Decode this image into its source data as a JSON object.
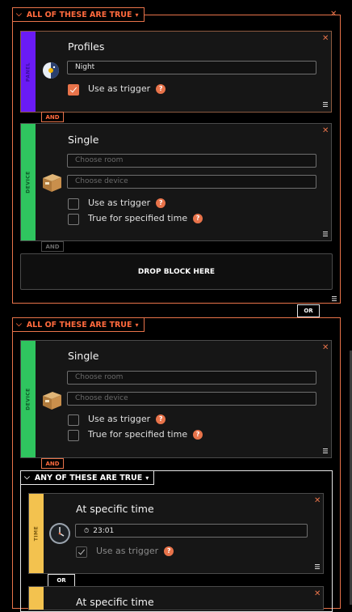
{
  "groups": {
    "all_true_label": "ALL OF THESE ARE TRUE",
    "any_true_label": "ANY OF THESE ARE TRUE"
  },
  "connectors": {
    "and": "AND",
    "or": "OR"
  },
  "stripe_labels": {
    "panel": "PANEL",
    "device": "DEVICE",
    "time": "TIME"
  },
  "profiles_block": {
    "title": "Profiles",
    "value": "Night",
    "trigger_label": "Use as trigger",
    "trigger_checked": true
  },
  "device_block_1": {
    "title": "Single",
    "room_placeholder": "Choose room",
    "device_placeholder": "Choose device",
    "trigger_label": "Use as trigger",
    "time_label": "True for specified time"
  },
  "drop_zone": {
    "label": "DROP BLOCK HERE"
  },
  "device_block_2": {
    "title": "Single",
    "room_placeholder": "Choose room",
    "device_placeholder": "Choose device",
    "trigger_label": "Use as trigger",
    "time_label": "True for specified time"
  },
  "time_block_1": {
    "title": "At specific time",
    "time_value": "23:01",
    "trigger_label": "Use as trigger",
    "trigger_checked": true
  },
  "time_block_2": {
    "title": "At specific time"
  },
  "icons": {
    "close": "✕",
    "help": "?",
    "chevron": "chevron-down-icon",
    "caret": "▾",
    "clock_small": "⏱"
  },
  "colors": {
    "accent": "#e8734a",
    "panel_stripe": "#6a1bf5",
    "device_stripe": "#2fc55f",
    "time_stripe": "#f3c24f"
  }
}
